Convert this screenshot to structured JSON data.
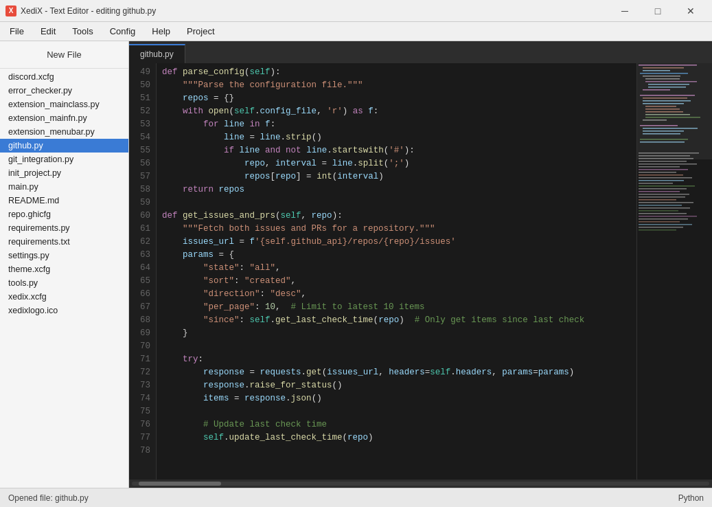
{
  "titlebar": {
    "icon_label": "X",
    "title": "XediX - Text Editor - editing github.py",
    "minimize_label": "─",
    "maximize_label": "□",
    "close_label": "✕"
  },
  "menubar": {
    "items": [
      "File",
      "Edit",
      "Tools",
      "Config",
      "Help",
      "Project"
    ]
  },
  "sidebar": {
    "header": "New File",
    "files": [
      {
        "name": "discord.xcfg",
        "active": false
      },
      {
        "name": "error_checker.py",
        "active": false
      },
      {
        "name": "extension_mainclass.py",
        "active": false
      },
      {
        "name": "extension_mainfn.py",
        "active": false
      },
      {
        "name": "extension_menubar.py",
        "active": false
      },
      {
        "name": "github.py",
        "active": true
      },
      {
        "name": "git_integration.py",
        "active": false
      },
      {
        "name": "init_project.py",
        "active": false
      },
      {
        "name": "main.py",
        "active": false
      },
      {
        "name": "README.md",
        "active": false
      },
      {
        "name": "repo.ghicfg",
        "active": false
      },
      {
        "name": "requirements.py",
        "active": false
      },
      {
        "name": "requirements.txt",
        "active": false
      },
      {
        "name": "settings.py",
        "active": false
      },
      {
        "name": "theme.xcfg",
        "active": false
      },
      {
        "name": "tools.py",
        "active": false
      },
      {
        "name": "xedix.xcfg",
        "active": false
      },
      {
        "name": "xedixlogo.ico",
        "active": false
      }
    ]
  },
  "tab": {
    "label": "github.py"
  },
  "statusbar": {
    "left": "Opened file: github.py",
    "right": "Python"
  }
}
